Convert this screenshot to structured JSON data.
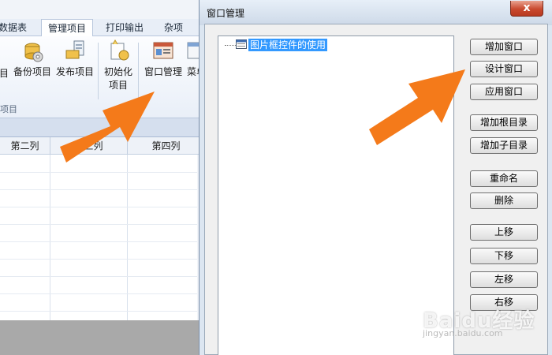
{
  "app": {
    "tabs": [
      {
        "label": "数据表"
      },
      {
        "label": "管理项目"
      },
      {
        "label": "打印输出"
      },
      {
        "label": "杂项"
      }
    ],
    "active_tab": "管理项目",
    "ribbon_buttons": [
      {
        "label": "目"
      },
      {
        "label": "备份项目"
      },
      {
        "label": "发布项目"
      },
      {
        "label": "初始化项目",
        "line1": "初始化",
        "line2": "项目"
      },
      {
        "label": "窗口管理"
      },
      {
        "label": "菜单"
      }
    ],
    "group_label": "项目",
    "grid_columns": [
      "第二列",
      "第三列",
      "第四列"
    ]
  },
  "dialog": {
    "title": "窗口管理",
    "close_glyph": "x",
    "tree_items": [
      {
        "label": "图片框控件的使用",
        "selected": true
      }
    ],
    "buttons": {
      "add_window": "增加窗口",
      "design_window": "设计窗口",
      "apply_window": "应用窗口",
      "add_root": "增加根目录",
      "add_subdir": "增加子目录",
      "rename": "重命名",
      "delete": "删除",
      "move_up": "上移",
      "move_down": "下移",
      "move_left": "左移",
      "move_right": "右移"
    }
  },
  "colors": {
    "arrow": "#f47a1a",
    "selection": "#3399ff",
    "close_button": "#c94a2f"
  }
}
